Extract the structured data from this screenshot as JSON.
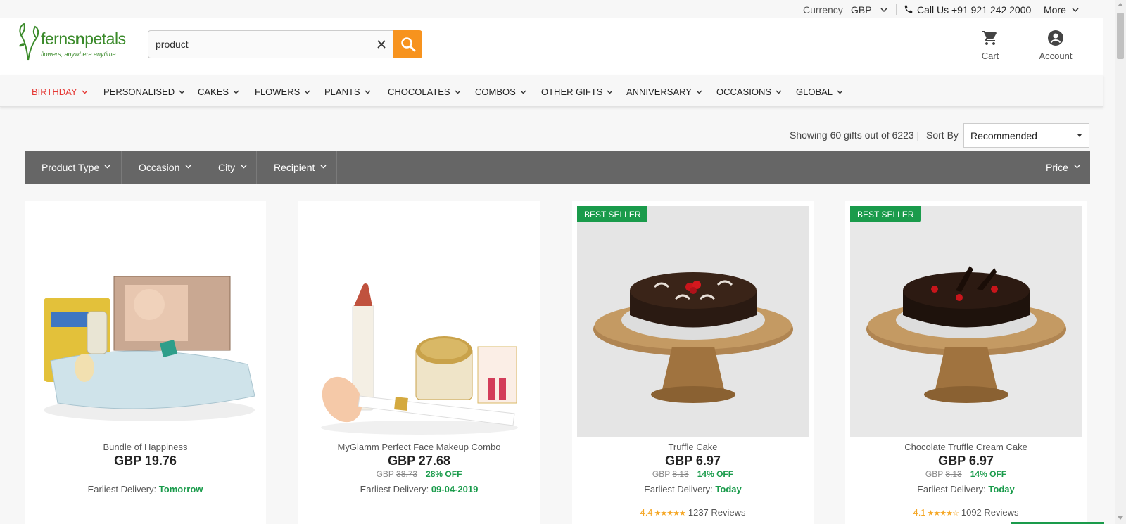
{
  "topbar": {
    "currency_label": "Currency",
    "currency_value": "GBP",
    "call_us": "Call Us +91 921 242 2000",
    "more": "More"
  },
  "header": {
    "logo_text_ferns": "ferns",
    "logo_text_n": "n",
    "logo_text_petals": "petals",
    "logo_tagline": "flowers, anywhere anytime...",
    "search_value": "product",
    "cart_label": "Cart",
    "account_label": "Account"
  },
  "nav": {
    "items": [
      "BIRTHDAY",
      "PERSONALISED",
      "CAKES",
      "FLOWERS",
      "PLANTS",
      "CHOCOLATES",
      "COMBOS",
      "OTHER GIFTS",
      "ANNIVERSARY",
      "OCCASIONS",
      "GLOBAL"
    ],
    "active": "BIRTHDAY"
  },
  "results": {
    "text": "Showing 60 gifts out of 6223 |",
    "sort_label": "Sort By",
    "sort_value": "Recommended"
  },
  "filters": [
    "Product Type",
    "Occasion",
    "City",
    "Recipient",
    "Price"
  ],
  "products": [
    {
      "name": "Bundle of Happiness",
      "price": "GBP  19.76",
      "delivery_label": "Earliest Delivery:",
      "delivery_value": "Tomorrow"
    },
    {
      "name": "MyGlamm Perfect Face Makeup Combo",
      "price": "GBP  27.68",
      "orig_currency": "GBP",
      "orig_price": "38.73",
      "discount": "28% OFF",
      "delivery_label": "Earliest Delivery:",
      "delivery_value": "09-04-2019"
    },
    {
      "badge": "BEST SELLER",
      "name": "Truffle Cake",
      "price": "GBP  6.97",
      "orig_currency": "GBP",
      "orig_price": "8.13",
      "discount": "14% OFF",
      "delivery_label": "Earliest Delivery:",
      "delivery_value": "Today",
      "rating": "4.4",
      "stars": "★★★★★",
      "reviews": "1237 Reviews"
    },
    {
      "badge": "BEST SELLER",
      "name": "Chocolate Truffle Cream Cake",
      "price": "GBP  6.97",
      "orig_currency": "GBP",
      "orig_price": "8.13",
      "discount": "14% OFF",
      "delivery_label": "Earliest Delivery:",
      "delivery_value": "Today",
      "rating": "4.1",
      "stars": "★★★★☆",
      "reviews": "1092 Reviews"
    }
  ],
  "colors": {
    "brand_green": "#3a8a2a",
    "search_orange": "#f7931e",
    "nav_active_red": "#e53935",
    "filter_bar": "#666666",
    "badge_green": "#1a9b4b",
    "star_orange": "#f5a623"
  },
  "icons": [
    "chevron-down-icon",
    "phone-icon",
    "close-icon",
    "search-icon",
    "cart-icon",
    "account-icon"
  ]
}
